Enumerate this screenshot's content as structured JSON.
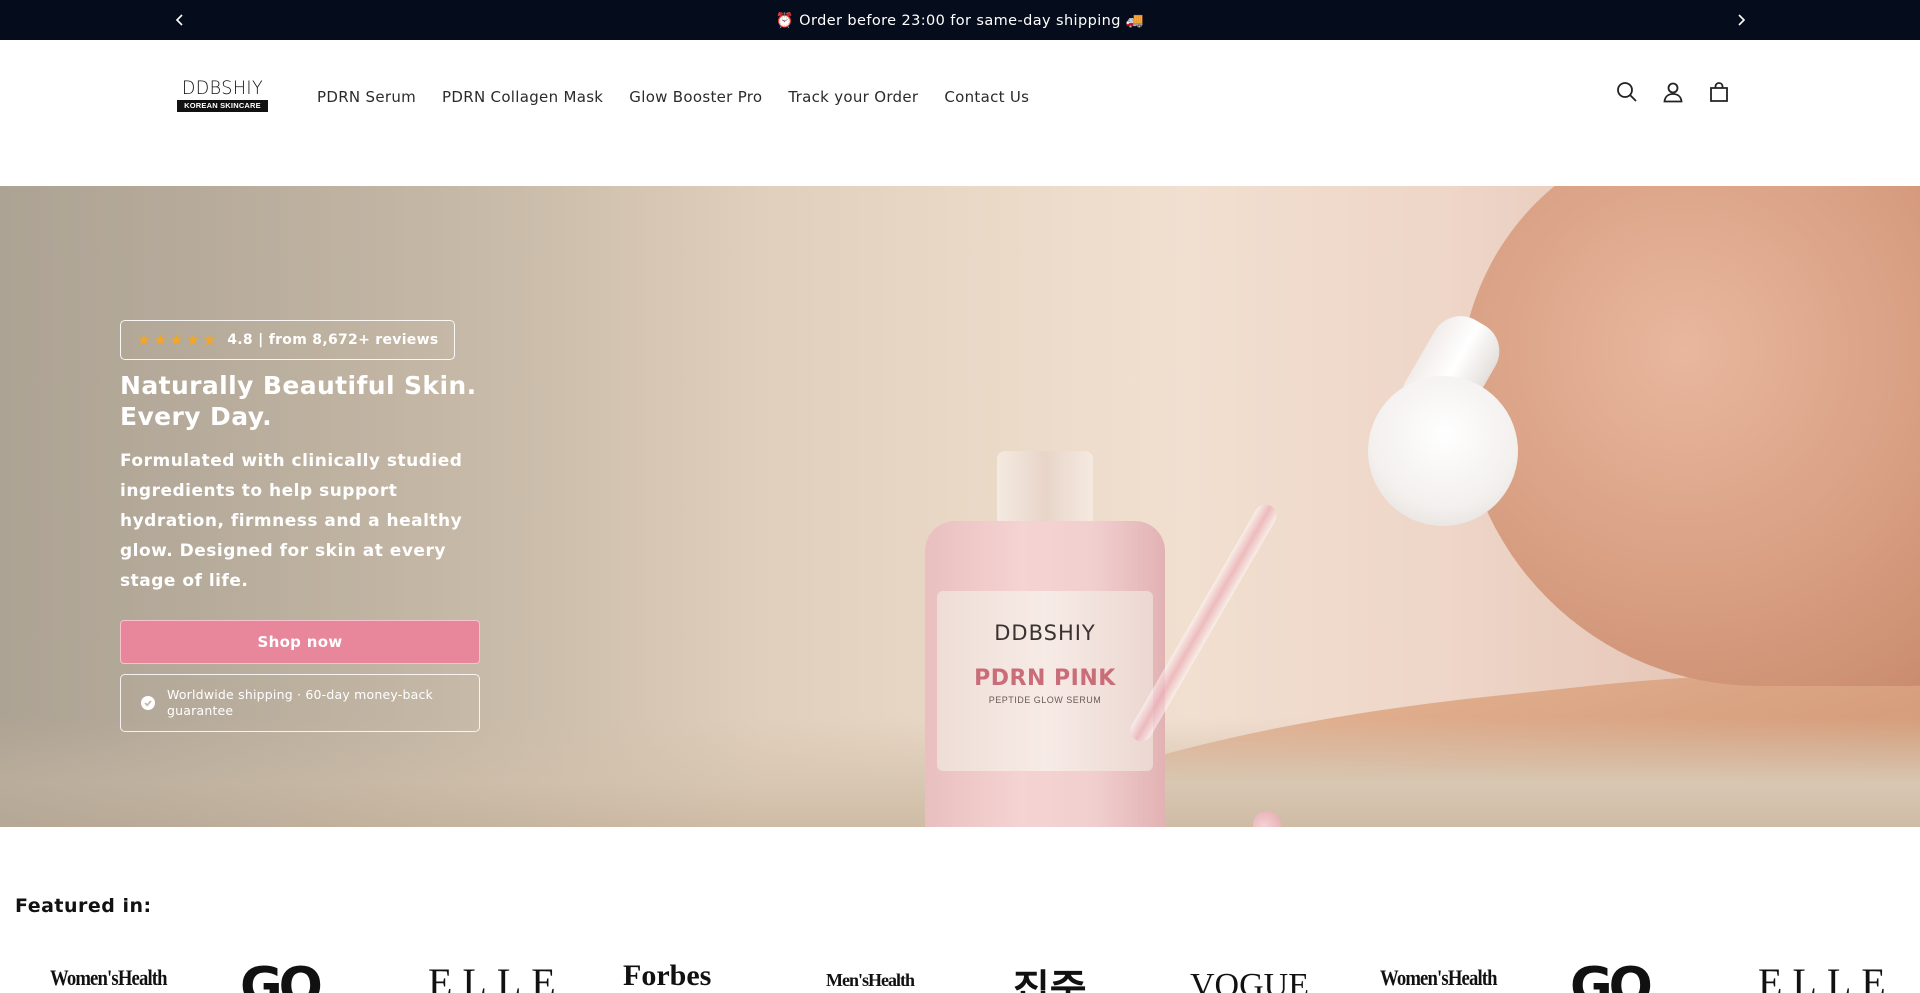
{
  "announcement": {
    "text": "⏰ Order before 23:00 for same-day shipping 🚚",
    "prev_icon": "chevron-left-icon",
    "next_icon": "chevron-right-icon"
  },
  "header": {
    "logo": {
      "wordmark": "DDBSHIY",
      "tagline": "KOREAN SKINCARE"
    },
    "nav": [
      {
        "label": "PDRN Serum"
      },
      {
        "label": "PDRN Collagen Mask"
      },
      {
        "label": "Glow Booster Pro"
      },
      {
        "label": "Track your Order"
      },
      {
        "label": "Contact Us"
      }
    ],
    "icons": [
      "search-icon",
      "account-icon",
      "cart-icon"
    ]
  },
  "hero": {
    "rating": {
      "stars": "★★★★★",
      "text": "4.8 | from 8,672+ reviews",
      "value": 4.8
    },
    "title_line1": "Naturally Beautiful Skin.",
    "title_line2": "Every Day.",
    "description": "Formulated with clinically studied ingredients to help support hydration, firmness and a healthy glow. Designed for skin at every stage of life.",
    "cta": "Shop now",
    "guarantee": "Worldwide shipping · 60-day money-back guarantee",
    "product": {
      "brand": "DDBSHIY",
      "name": "PDRN PINK",
      "sub": "PEPTIDE GLOW SERUM"
    }
  },
  "featured": {
    "title": "Featured in:",
    "logos": [
      "Women'sHealth",
      "GQ",
      "ELLE",
      "Forbes",
      "Men'sHealth",
      "집중",
      "VOGUE",
      "Women'sHealth",
      "GQ",
      "ELLE"
    ]
  },
  "colors": {
    "announcement_bg": "#050d1c",
    "cta_bg": "#e8869c",
    "star": "#f5a623"
  }
}
